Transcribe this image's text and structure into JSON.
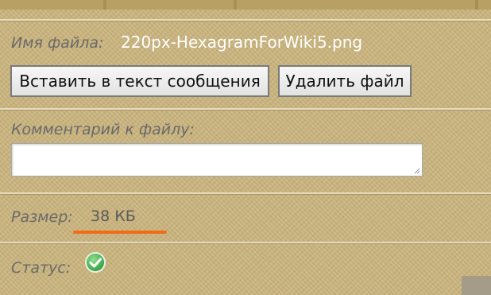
{
  "file": {
    "name_label": "Имя файла:",
    "name_value": "220px-HexagramForWiki5.png"
  },
  "buttons": {
    "insert_label": "Вставить в текст сообщения",
    "delete_label": "Удалить файл"
  },
  "comment": {
    "label": "Комментарий к файлу:",
    "value": ""
  },
  "size": {
    "label": "Размер:",
    "value": "38 КБ"
  },
  "status": {
    "label": "Статус:",
    "icon": "check-circle-icon",
    "state": "ok"
  },
  "colors": {
    "panel_bg": "#cbb57e",
    "highlight_underline": "#f26b1d",
    "status_ok": "#3fb34f"
  }
}
